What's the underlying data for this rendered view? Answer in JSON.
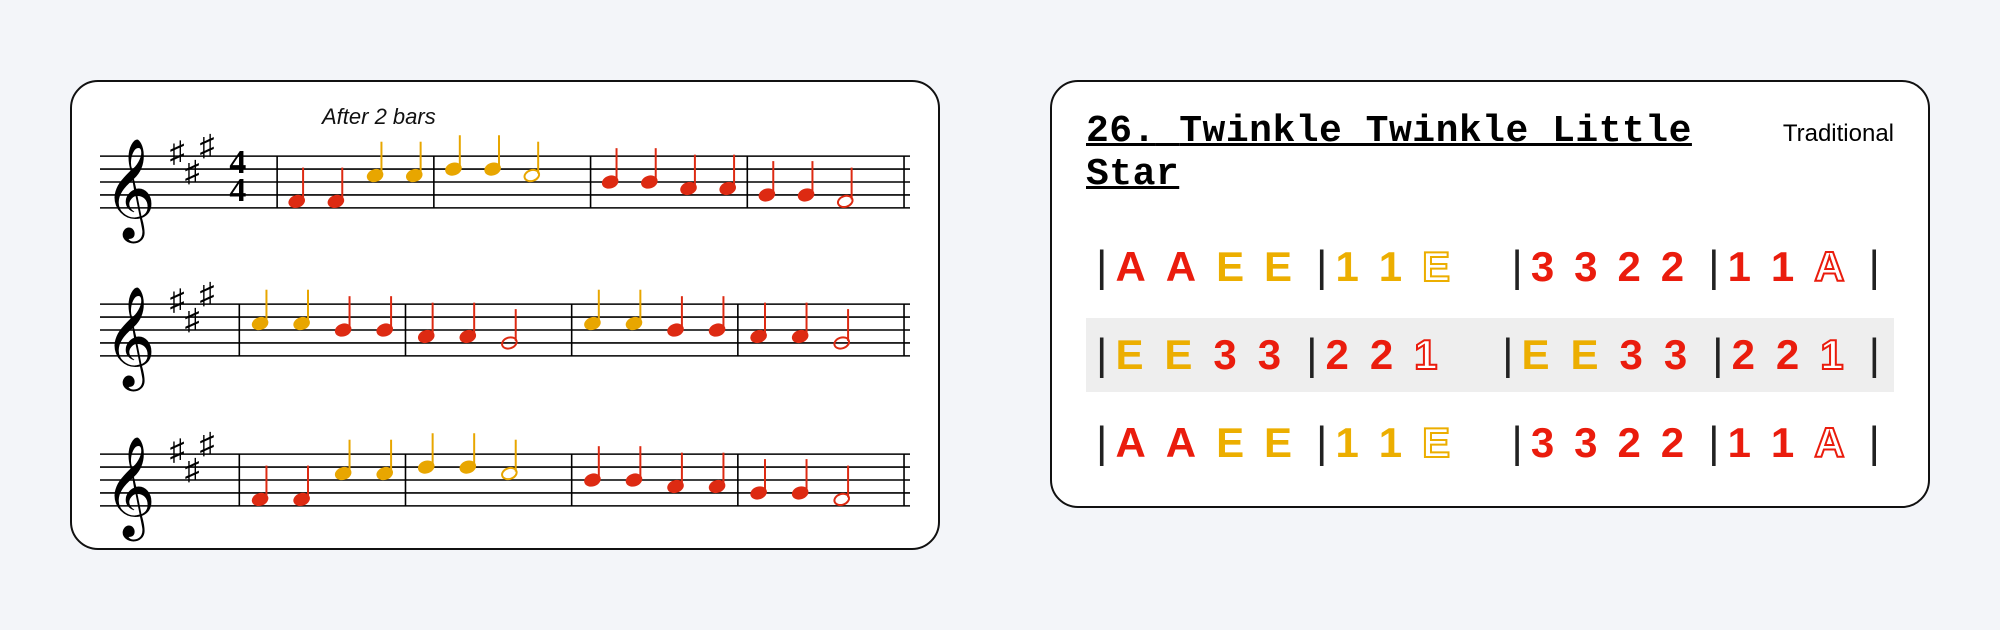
{
  "left": {
    "instruction": "After 2 bars",
    "key_signature": "A major (3 sharps)",
    "time_signature": "4/4",
    "colors": {
      "low": "#dd2a12",
      "high": "#e8a600"
    },
    "staves": [
      {
        "show_time_sig": true,
        "bars": [
          {
            "notes": [
              {
                "p": 0,
                "c": "low"
              },
              {
                "p": 0,
                "c": "low"
              },
              {
                "p": 4,
                "c": "high"
              },
              {
                "p": 4,
                "c": "high"
              }
            ]
          },
          {
            "notes": [
              {
                "p": 5,
                "c": "high"
              },
              {
                "p": 5,
                "c": "high"
              },
              {
                "p": 4,
                "c": "high",
                "half": true
              }
            ]
          },
          {
            "notes": [
              {
                "p": 3,
                "c": "low"
              },
              {
                "p": 3,
                "c": "low"
              },
              {
                "p": 2,
                "c": "low"
              },
              {
                "p": 2,
                "c": "low"
              }
            ]
          },
          {
            "notes": [
              {
                "p": 1,
                "c": "low"
              },
              {
                "p": 1,
                "c": "low"
              },
              {
                "p": 0,
                "c": "low",
                "half": true
              }
            ]
          }
        ]
      },
      {
        "show_time_sig": false,
        "bars": [
          {
            "notes": [
              {
                "p": 4,
                "c": "high"
              },
              {
                "p": 4,
                "c": "high"
              },
              {
                "p": 3,
                "c": "low"
              },
              {
                "p": 3,
                "c": "low"
              }
            ]
          },
          {
            "notes": [
              {
                "p": 2,
                "c": "low"
              },
              {
                "p": 2,
                "c": "low"
              },
              {
                "p": 1,
                "c": "low",
                "half": true
              }
            ]
          },
          {
            "notes": [
              {
                "p": 4,
                "c": "high"
              },
              {
                "p": 4,
                "c": "high"
              },
              {
                "p": 3,
                "c": "low"
              },
              {
                "p": 3,
                "c": "low"
              }
            ]
          },
          {
            "notes": [
              {
                "p": 2,
                "c": "low"
              },
              {
                "p": 2,
                "c": "low"
              },
              {
                "p": 1,
                "c": "low",
                "half": true
              }
            ]
          }
        ]
      },
      {
        "show_time_sig": false,
        "bars": [
          {
            "notes": [
              {
                "p": 0,
                "c": "low"
              },
              {
                "p": 0,
                "c": "low"
              },
              {
                "p": 4,
                "c": "high"
              },
              {
                "p": 4,
                "c": "high"
              }
            ]
          },
          {
            "notes": [
              {
                "p": 5,
                "c": "high"
              },
              {
                "p": 5,
                "c": "high"
              },
              {
                "p": 4,
                "c": "high",
                "half": true
              }
            ]
          },
          {
            "notes": [
              {
                "p": 3,
                "c": "low"
              },
              {
                "p": 3,
                "c": "low"
              },
              {
                "p": 2,
                "c": "low"
              },
              {
                "p": 2,
                "c": "low"
              }
            ]
          },
          {
            "notes": [
              {
                "p": 1,
                "c": "low"
              },
              {
                "p": 1,
                "c": "low"
              },
              {
                "p": 0,
                "c": "low",
                "half": true
              }
            ]
          }
        ]
      }
    ]
  },
  "right": {
    "number": "26.",
    "title": "Twinkle Twinkle Little Star",
    "attribution": "Traditional",
    "lines": [
      {
        "shaded": false,
        "bars": [
          [
            {
              "t": "A",
              "s": "r"
            },
            {
              "t": "A",
              "s": "r"
            },
            {
              "t": "E",
              "s": "y"
            },
            {
              "t": "E",
              "s": "y"
            }
          ],
          [
            {
              "t": "1",
              "s": "y"
            },
            {
              "t": "1",
              "s": "y"
            },
            {
              "t": "E",
              "s": "yo"
            }
          ],
          [
            {
              "t": "3",
              "s": "r"
            },
            {
              "t": "3",
              "s": "r"
            },
            {
              "t": "2",
              "s": "r"
            },
            {
              "t": "2",
              "s": "r"
            }
          ],
          [
            {
              "t": "1",
              "s": "r"
            },
            {
              "t": "1",
              "s": "r"
            },
            {
              "t": "A",
              "s": "ro"
            }
          ]
        ]
      },
      {
        "shaded": true,
        "bars": [
          [
            {
              "t": "E",
              "s": "y"
            },
            {
              "t": "E",
              "s": "y"
            },
            {
              "t": "3",
              "s": "r"
            },
            {
              "t": "3",
              "s": "r"
            }
          ],
          [
            {
              "t": "2",
              "s": "r"
            },
            {
              "t": "2",
              "s": "r"
            },
            {
              "t": "1",
              "s": "ro"
            }
          ],
          [
            {
              "t": "E",
              "s": "y"
            },
            {
              "t": "E",
              "s": "y"
            },
            {
              "t": "3",
              "s": "r"
            },
            {
              "t": "3",
              "s": "r"
            }
          ],
          [
            {
              "t": "2",
              "s": "r"
            },
            {
              "t": "2",
              "s": "r"
            },
            {
              "t": "1",
              "s": "ro"
            }
          ]
        ]
      },
      {
        "shaded": false,
        "bars": [
          [
            {
              "t": "A",
              "s": "r"
            },
            {
              "t": "A",
              "s": "r"
            },
            {
              "t": "E",
              "s": "y"
            },
            {
              "t": "E",
              "s": "y"
            }
          ],
          [
            {
              "t": "1",
              "s": "y"
            },
            {
              "t": "1",
              "s": "y"
            },
            {
              "t": "E",
              "s": "yo"
            }
          ],
          [
            {
              "t": "3",
              "s": "r"
            },
            {
              "t": "3",
              "s": "r"
            },
            {
              "t": "2",
              "s": "r"
            },
            {
              "t": "2",
              "s": "r"
            }
          ],
          [
            {
              "t": "1",
              "s": "r"
            },
            {
              "t": "1",
              "s": "r"
            },
            {
              "t": "A",
              "s": "ro"
            }
          ]
        ]
      }
    ]
  }
}
